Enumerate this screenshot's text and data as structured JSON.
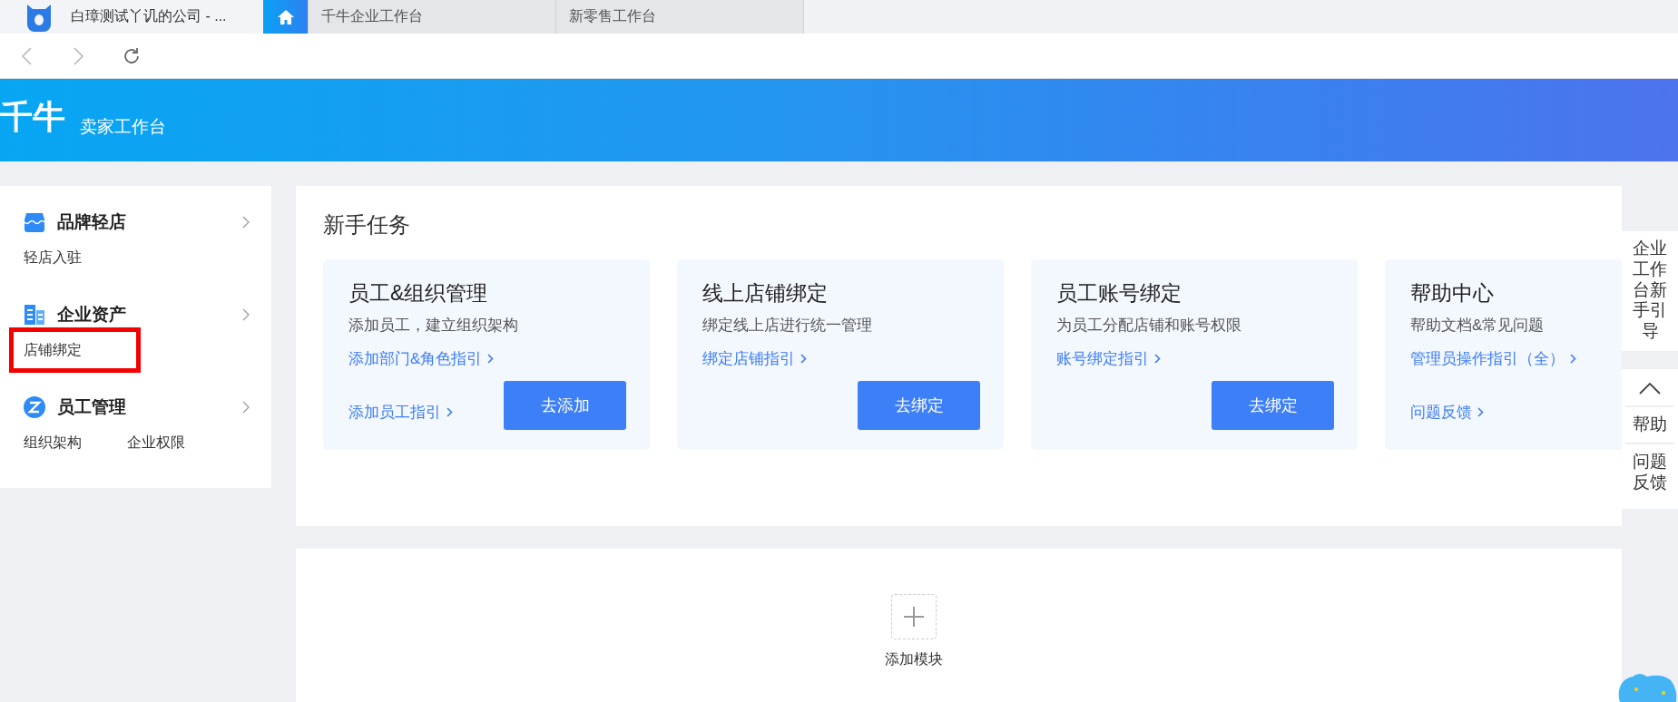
{
  "window": {
    "title": "白璋测试丫讥的公司 - ..."
  },
  "tabs": [
    {
      "kind": "home",
      "selected": true
    },
    {
      "kind": "text",
      "label": "千牛企业工作台",
      "selected": false
    },
    {
      "kind": "text",
      "label": "新零售工作台",
      "selected": false
    }
  ],
  "header": {
    "logo": "千牛",
    "subtitle": "卖家工作台"
  },
  "sidebar": {
    "groups": [
      {
        "title": "品牌轻店",
        "items": [
          {
            "label": "轻店入驻",
            "highlighted": false
          }
        ]
      },
      {
        "title": "企业资产",
        "items": [
          {
            "label": "店铺绑定",
            "highlighted": true
          }
        ]
      },
      {
        "title": "员工管理",
        "items": [
          {
            "label": "组织架构",
            "highlighted": false
          },
          {
            "label": "企业权限",
            "highlighted": false
          }
        ]
      }
    ]
  },
  "tasks": {
    "title": "新手任务",
    "cards": [
      {
        "title": "员工&组织管理",
        "description": "添加员工，建立组织架构",
        "links": [
          "添加部门&角色指引",
          "添加员工指引"
        ],
        "button": "去添加"
      },
      {
        "title": "线上店铺绑定",
        "description": "绑定线上店进行统一管理",
        "links": [
          "绑定店铺指引"
        ],
        "button": "去绑定"
      },
      {
        "title": "员工账号绑定",
        "description": "为员工分配店铺和账号权限",
        "links": [
          "账号绑定指引"
        ],
        "button": "去绑定"
      },
      {
        "title": "帮助中心",
        "description": "帮助文档&常见问题",
        "links": [
          "管理员操作指引（全）",
          "问题反馈"
        ]
      }
    ]
  },
  "add_module": {
    "label": "添加模块"
  },
  "float_panel": {
    "guide": "企业工作台新手引导",
    "items": [
      "帮助",
      "问题反馈"
    ]
  }
}
